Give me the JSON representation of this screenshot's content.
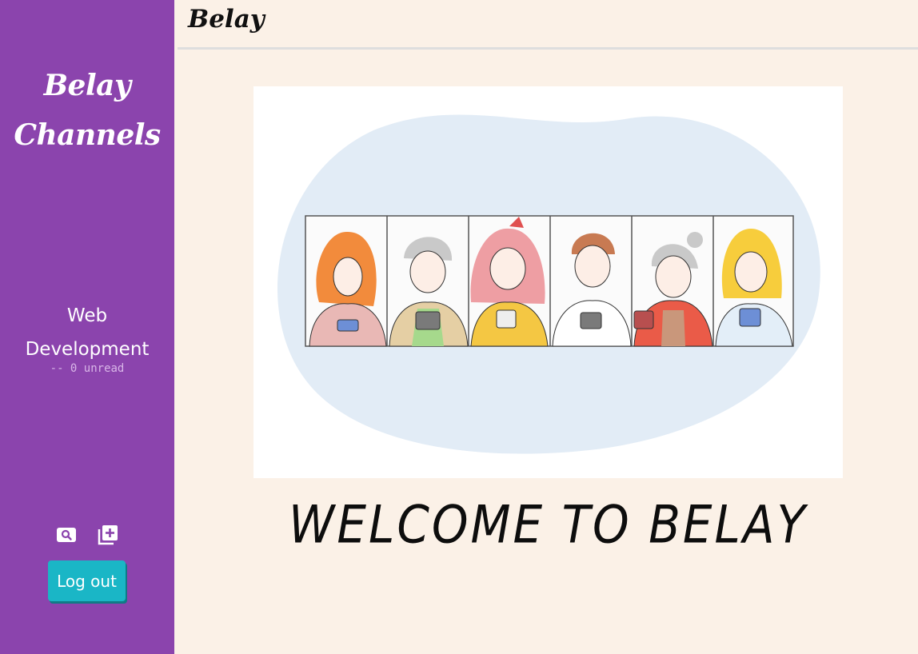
{
  "sidebar": {
    "title_line1": "Belay",
    "title_line2": "Channels",
    "channel": {
      "name_line1": "Web",
      "name_line2": "Development",
      "unread": "-- 0 unread"
    },
    "icons": [
      "search-icon",
      "add-channel-icon"
    ],
    "logout_label": "Log out",
    "background": "#8b44ad",
    "button_color": "#1ab6c6"
  },
  "header": {
    "title": "Belay"
  },
  "main": {
    "welcome_text": "WELCOME TO BELAY"
  }
}
